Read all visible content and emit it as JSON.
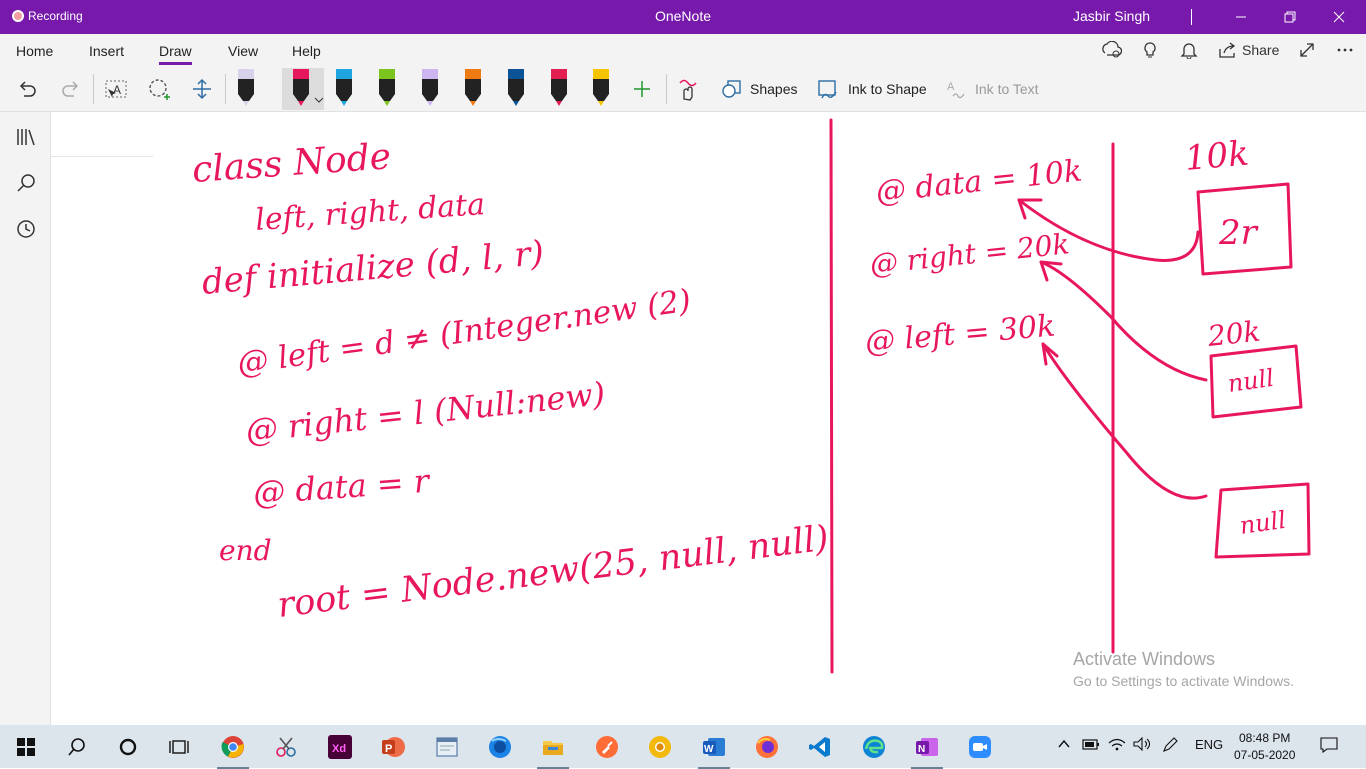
{
  "titlebar": {
    "recording": "Recording",
    "app_title": "OneNote",
    "user": "Jasbir Singh"
  },
  "menu": {
    "tabs": [
      "Home",
      "Insert",
      "Draw",
      "View",
      "Help"
    ],
    "active_tab": "Draw",
    "share": "Share"
  },
  "toolbar": {
    "shapes": "Shapes",
    "ink_to_shape": "Ink to Shape",
    "ink_to_text": "Ink to Text",
    "pen_colors": [
      "#d9d1ec",
      "#e8175d",
      "#1fa6e0",
      "#7cc41e",
      "#cdb6f0",
      "#f07a12",
      "#0b5394",
      "#e31f52",
      "#f5c400"
    ]
  },
  "canvas": {
    "ink_color": "#e8175d",
    "handwriting": {
      "line1": "class Node",
      "line2": "left, right, data",
      "line3": "def initialize (d, l, r)",
      "line4": "@ left = d ≠ (Integer.new (2)",
      "line5": "@ right = l (Null:new)",
      "line6": "@ data = r",
      "line7": "end",
      "line8": "root = Node.new(25, null, null)",
      "r1": "@ data = 10k",
      "r2": "@ right = 20k",
      "r3": "@ left = 30k",
      "b1_label": "10k",
      "b1_val": "2r",
      "b2_label": "20k",
      "b2_val": "null",
      "b3_val": "null"
    }
  },
  "watermark": {
    "line1": "Activate Windows",
    "line2": "Go to Settings to activate Windows."
  },
  "taskbar": {
    "lang": "ENG",
    "time": "08:48 PM",
    "date": "07-05-2020"
  }
}
